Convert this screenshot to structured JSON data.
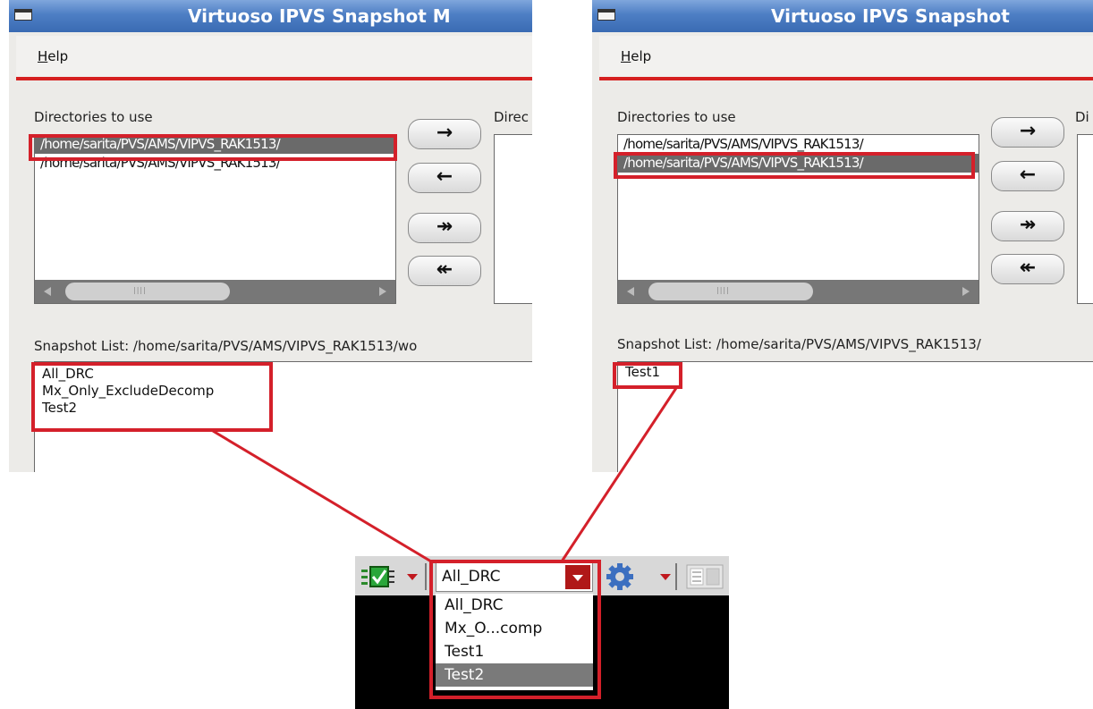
{
  "left_window": {
    "title": "Virtuoso IPVS Snapshot M",
    "menu_help": "Help",
    "dirs_label": "Directories to use",
    "dest_label": "Direc",
    "dirs": [
      "/home/sarita/PVS/AMS/VIPVS_RAK1513/",
      "/home/sarita/PVS/AMS/VIPVS_RAK1513/"
    ],
    "selected_dir_index": 0,
    "snapshot_label": "Snapshot List: /home/sarita/PVS/AMS/VIPVS_RAK1513/wo",
    "snapshots": [
      "All_DRC",
      "Mx_Only_ExcludeDecomp",
      "Test2"
    ]
  },
  "right_window": {
    "title": "Virtuoso IPVS Snapshot",
    "menu_help": "Help",
    "dirs_label": "Directories to use",
    "dest_label": "Di",
    "dirs": [
      "/home/sarita/PVS/AMS/VIPVS_RAK1513/",
      "/home/sarita/PVS/AMS/VIPVS_RAK1513/"
    ],
    "selected_dir_index": 1,
    "snapshot_label": "Snapshot List: /home/sarita/PVS/AMS/VIPVS_RAK1513/",
    "snapshots": [
      "Test1"
    ]
  },
  "buttons": {
    "move_right": "→",
    "move_left": "←",
    "move_all_right": "↠",
    "move_all_left": "↞"
  },
  "toolbar": {
    "combo_value": "All_DRC",
    "options": [
      "All_DRC",
      "Mx_O...comp",
      "Test1",
      "Test2"
    ],
    "highlighted_option_index": 3
  },
  "colors": {
    "highlight": "#d4202a",
    "title_bar": "#4d7ec4"
  }
}
